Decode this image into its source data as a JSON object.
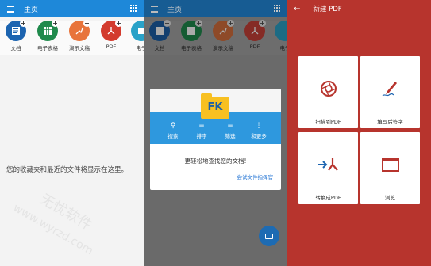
{
  "screen1": {
    "title": "主页",
    "shortcuts": [
      {
        "label": "文档",
        "color": "#1c64b0"
      },
      {
        "label": "电子表格",
        "color": "#1f8a4c"
      },
      {
        "label": "演示文稿",
        "color": "#e8743b"
      },
      {
        "label": "PDF",
        "color": "#d33b2e"
      },
      {
        "label": "电子",
        "color": "#2aa2c8"
      }
    ],
    "empty_message": "您的收藏夹和最近的文件将显示在这里。"
  },
  "screen2": {
    "title": "主页",
    "shortcuts": [
      {
        "label": "文档",
        "color": "#123f6f"
      },
      {
        "label": "电子表格",
        "color": "#155c33"
      },
      {
        "label": "演示文稿",
        "color": "#8e4a28"
      },
      {
        "label": "PDF",
        "color": "#852b25"
      },
      {
        "label": "电子",
        "color": "#1c6b84"
      }
    ],
    "dialog": {
      "logo_text": "FK",
      "tools": [
        {
          "label": "搜索",
          "icon": "search-icon"
        },
        {
          "label": "排序",
          "icon": "sort-icon"
        },
        {
          "label": "筛选",
          "icon": "filter-icon"
        },
        {
          "label": "和更多",
          "icon": "more-icon"
        }
      ],
      "message": "更轻松地查找您的文档!",
      "link": "尝试文件指挥官"
    }
  },
  "screen3": {
    "title": "新建 PDF",
    "cards": [
      {
        "label": "扫描到PDF",
        "icon": "camera-shutter-icon"
      },
      {
        "label": "填写后签字",
        "icon": "pen-signature-icon"
      },
      {
        "label": "转换成PDF",
        "icon": "convert-pdf-icon"
      },
      {
        "label": "浏览",
        "icon": "browse-window-icon"
      }
    ]
  },
  "watermark": {
    "line1": "无忧软件",
    "line2": "www.wyrzd.com"
  }
}
